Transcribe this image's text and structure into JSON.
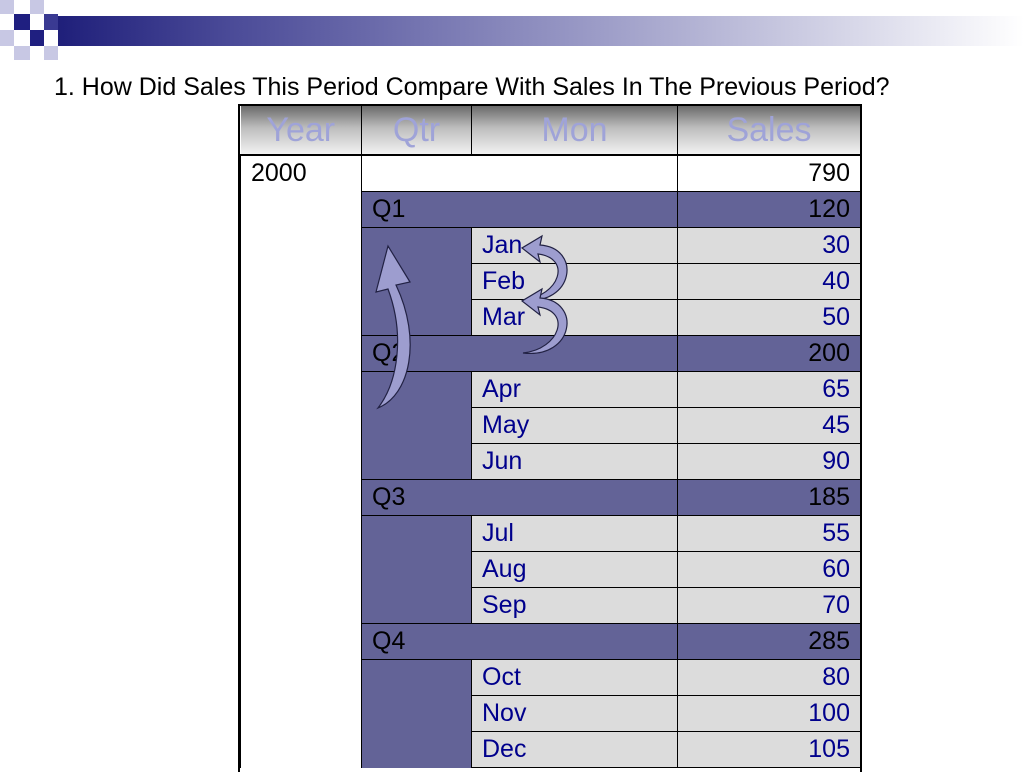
{
  "slide": {
    "title": "1. How Did Sales This Period Compare With Sales In The Previous Period?"
  },
  "table": {
    "headers": [
      "Year",
      "Qtr",
      "Mon",
      "Sales"
    ],
    "year": {
      "label": "2000",
      "sales": "790"
    },
    "quarters": [
      {
        "label": "Q1",
        "sales": "120",
        "months": [
          {
            "label": "Jan",
            "sales": "30"
          },
          {
            "label": "Feb",
            "sales": "40"
          },
          {
            "label": "Mar",
            "sales": "50"
          }
        ]
      },
      {
        "label": "Q2",
        "sales": "200",
        "months": [
          {
            "label": "Apr",
            "sales": "65"
          },
          {
            "label": "May",
            "sales": "45"
          },
          {
            "label": "Jun",
            "sales": "90"
          }
        ]
      },
      {
        "label": "Q3",
        "sales": "185",
        "months": [
          {
            "label": "Jul",
            "sales": "55"
          },
          {
            "label": "Aug",
            "sales": "60"
          },
          {
            "label": "Sep",
            "sales": "70"
          }
        ]
      },
      {
        "label": "Q4",
        "sales": "285",
        "months": [
          {
            "label": "Oct",
            "sales": "80"
          },
          {
            "label": "Nov",
            "sales": "100"
          },
          {
            "label": "Dec",
            "sales": "105"
          }
        ]
      }
    ]
  },
  "colors": {
    "quarter_fill": "#636397",
    "month_fill": "#dcdcdc",
    "month_text": "#00008c",
    "header_text": "#9fa3d8",
    "arrow_fill": "#9d9dcf"
  },
  "icons": [
    "curved-up-arrow-icon",
    "curved-left-arrow-icon"
  ]
}
